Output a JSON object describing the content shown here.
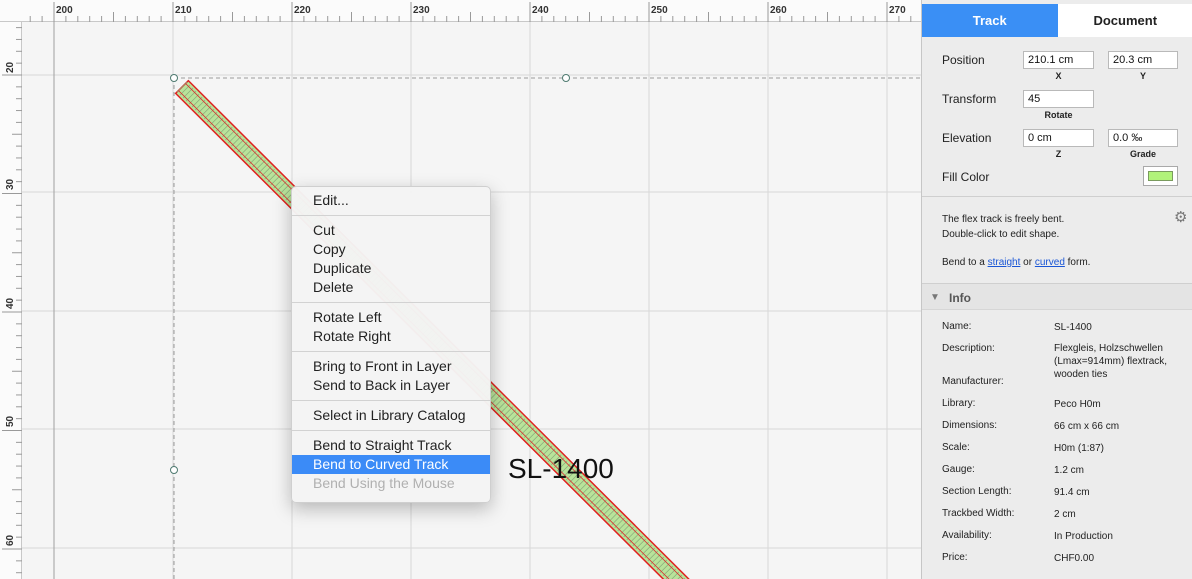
{
  "ruler": {
    "x_labels": [
      "200",
      "210",
      "220",
      "230",
      "240",
      "250",
      "260",
      "270"
    ],
    "y_labels": [
      "20",
      "30",
      "40",
      "50",
      "60"
    ]
  },
  "canvas": {
    "track_label": "SL-1400",
    "track_fill_color": "#b8e39a",
    "track_outline_color": "#e02020"
  },
  "context_menu": {
    "groups": [
      [
        "Edit..."
      ],
      [
        "Cut",
        "Copy",
        "Duplicate",
        "Delete"
      ],
      [
        "Rotate Left",
        "Rotate Right"
      ],
      [
        "Bring to Front in Layer",
        "Send to Back in Layer"
      ],
      [
        "Select in Library Catalog"
      ],
      [
        "Bend to Straight Track",
        "Bend to Curved Track",
        "Bend Using the Mouse"
      ]
    ],
    "highlighted": "Bend to Curved Track",
    "disabled": [
      "Bend Using the Mouse"
    ]
  },
  "inspector": {
    "tabs": [
      "Track",
      "Document"
    ],
    "active_tab": "Track",
    "position_label": "Position",
    "position_x": "210.1 cm",
    "position_y": "20.3 cm",
    "x_caption": "X",
    "y_caption": "Y",
    "transform_label": "Transform",
    "rotate_value": "45",
    "rotate_caption": "Rotate",
    "elevation_label": "Elevation",
    "z_value": "0 cm",
    "grade_value": "0.0 ‰",
    "z_caption": "Z",
    "grade_caption": "Grade",
    "fill_color_label": "Fill Color",
    "fill_color": "#b1f27a",
    "description_line1": "The flex track is freely bent.",
    "description_line2": "Double-click to edit shape.",
    "bend_prefix": "Bend to a",
    "bend_link_straight": "straight",
    "bend_or": "or",
    "bend_link_curved": "curved",
    "bend_suffix": "form.",
    "info_title": "Info",
    "info_rows": [
      {
        "key": "Name:",
        "value": "SL-1400"
      },
      {
        "key": "Description:",
        "value": "Flexgleis, Holzschwellen (Lmax=914mm)  flextrack, wooden ties"
      },
      {
        "key": "Manufacturer:",
        "value": ""
      },
      {
        "key": "Library:",
        "value": "Peco H0m"
      },
      {
        "key": "Dimensions:",
        "value": "66 cm x 66 cm"
      },
      {
        "key": "Scale:",
        "value": "H0m  (1:87)"
      },
      {
        "key": "Gauge:",
        "value": "1.2 cm"
      },
      {
        "key": "Section Length:",
        "value": "91.4 cm"
      },
      {
        "key": "Trackbed Width:",
        "value": "2 cm"
      },
      {
        "key": "Availability:",
        "value": "In Production"
      },
      {
        "key": "Price:",
        "value": "CHF0.00"
      }
    ]
  }
}
